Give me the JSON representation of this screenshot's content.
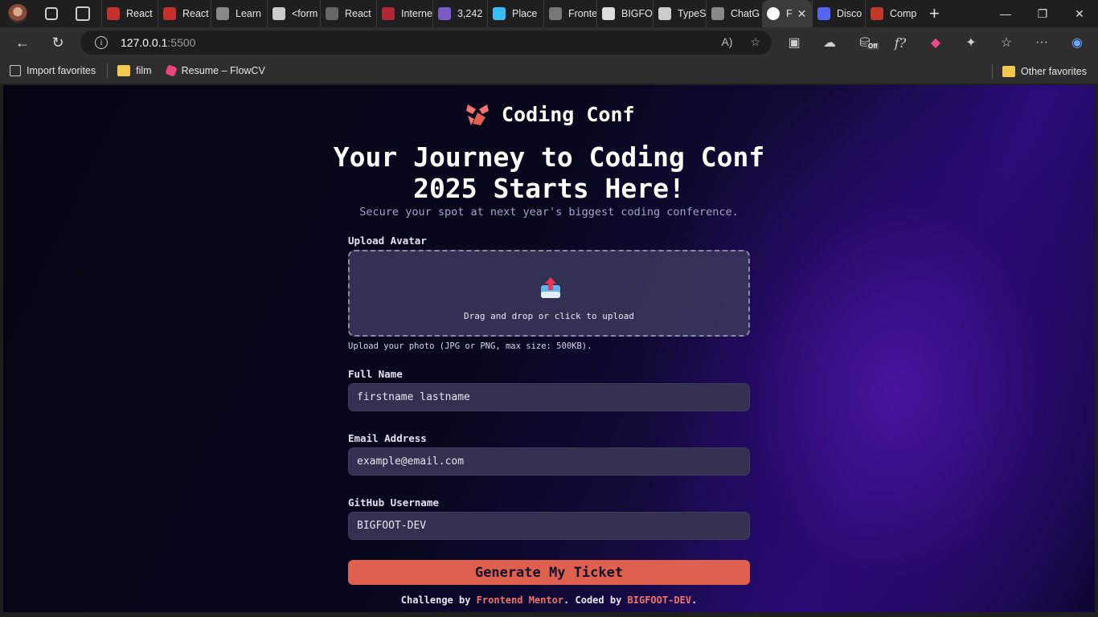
{
  "browser": {
    "tabs": [
      {
        "label": "React",
        "fav_color": "#c4302b"
      },
      {
        "label": "React",
        "fav_color": "#c4302b"
      },
      {
        "label": "Learn",
        "fav_color": "#888888"
      },
      {
        "label": "<form",
        "fav_color": "#cccccc"
      },
      {
        "label": "React",
        "fav_color": "#666666"
      },
      {
        "label": "Interne",
        "fav_color": "#b0273a"
      },
      {
        "label": "3,242",
        "fav_color": "#7b5cc4"
      },
      {
        "label": "Place",
        "fav_color": "#38bdf8"
      },
      {
        "label": "Fronte",
        "fav_color": "#777777"
      },
      {
        "label": "BIGFO",
        "fav_color": "#dddddd"
      },
      {
        "label": "TypeS",
        "fav_color": "#cccccc"
      },
      {
        "label": "ChatG",
        "fav_color": "#888888"
      },
      {
        "label": "F",
        "fav_color": "#ffffff",
        "active": true
      },
      {
        "label": "Disco",
        "fav_color": "#5865f2"
      },
      {
        "label": "Comp",
        "fav_color": "#c0392b"
      }
    ],
    "url_host": "127.0.0.1",
    "url_port": ":5500",
    "favorites": {
      "import": "Import favorites",
      "film": "film",
      "resume": "Resume – FlowCV",
      "other": "Other favorites"
    },
    "extension_badge": "Off"
  },
  "page": {
    "logo_text": "Coding Conf",
    "headline": "Your Journey to Coding Conf 2025 Starts Here!",
    "subheadline": "Secure your spot at next year's biggest coding conference.",
    "upload": {
      "label": "Upload Avatar",
      "text": "Drag and drop or click to upload",
      "hint": "Upload your photo (JPG or PNG, max size: 500KB)."
    },
    "full_name": {
      "label": "Full Name",
      "value": "firstname lastname"
    },
    "email": {
      "label": "Email Address",
      "value": "example@email.com"
    },
    "github": {
      "label": "GitHub Username",
      "value": "BIGFOOT-DEV"
    },
    "submit_label": "Generate My Ticket",
    "footer": {
      "prefix": "Challenge by ",
      "link1": "Frontend Mentor",
      "middle": ". Coded by ",
      "link2": "BIGFOOT-DEV",
      "suffix": "."
    },
    "colors": {
      "accent": "#e0604f",
      "field_bg": "#33314f",
      "link": "#f0726a"
    }
  }
}
